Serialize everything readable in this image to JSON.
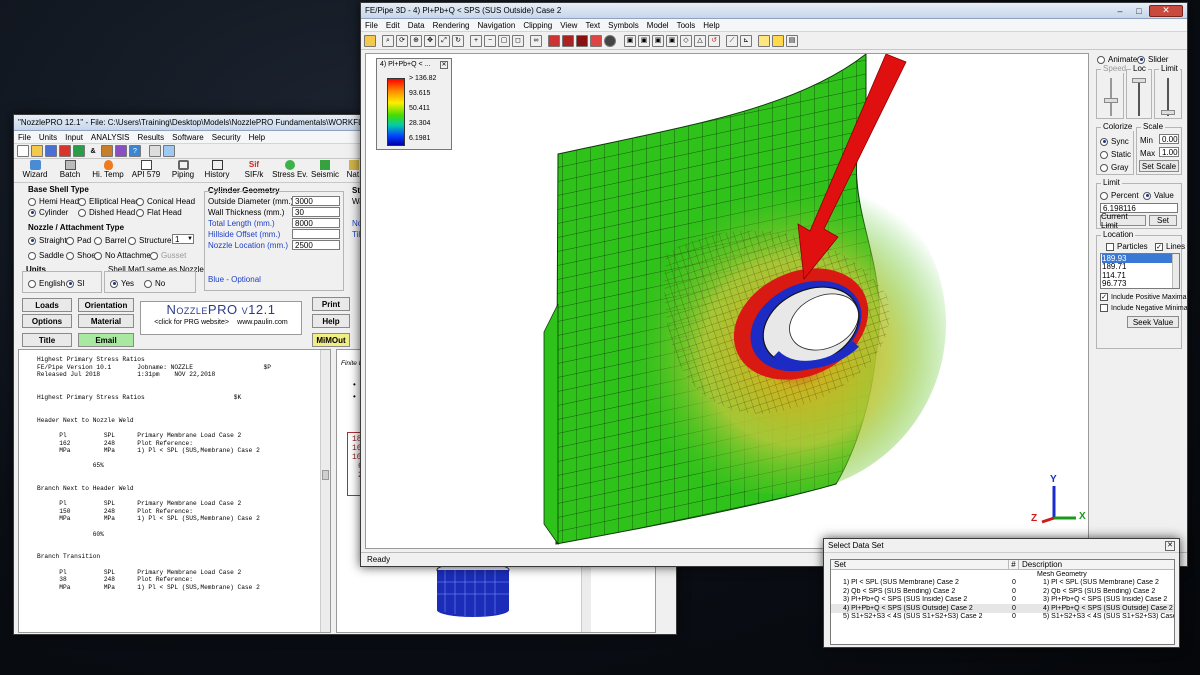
{
  "nozzle_window": {
    "title": "\"NozzlePRO 12.1\" - File: C:\\Users\\Training\\Desktop\\Models\\NozzlePRO Fundamentals\\WORKFLOW",
    "menu": [
      "File",
      "Units",
      "Input",
      "ANALYSIS",
      "Results",
      "Software",
      "Security",
      "Help"
    ],
    "toolbar": [
      "Wizard",
      "Batch",
      "Hi. Temp",
      "API 579",
      "Piping",
      "History",
      "SIF/k",
      "Stress Ev.",
      "Seismic",
      "Nat."
    ],
    "base_shell": {
      "title": "Base Shell Type",
      "options": [
        "Hemi Head",
        "Elliptical Head",
        "Conical Head",
        "Cylinder",
        "Dished Head",
        "Flat Head"
      ],
      "selected": "Cylinder"
    },
    "cylinder": {
      "title": "Cylinder Geometry",
      "fields": [
        {
          "label": "Outside Diameter (mm.)",
          "value": "3000",
          "blue": false
        },
        {
          "label": "Wall Thickness (mm.)",
          "value": "30",
          "blue": false
        },
        {
          "label": "Total Length (mm.)",
          "value": "8000",
          "blue": true
        },
        {
          "label": "Hillside Offset (mm.)",
          "value": "",
          "blue": true
        },
        {
          "label": "Nozzle Location (mm.)",
          "value": "2500",
          "blue": true
        }
      ],
      "note": "Blue - Optional"
    },
    "partial_labels": [
      "St",
      "Wa",
      "No",
      "Tilt"
    ],
    "nozzle_type": {
      "title": "Nozzle / Attachment Type",
      "options": [
        "Straight",
        "Pad",
        "Barrel",
        "Structure",
        "Saddle",
        "Shoe",
        "No Attachment",
        "Gusset"
      ],
      "selected": "Straight",
      "count": "1"
    },
    "units": {
      "title": "Units",
      "options": [
        "English",
        "SI"
      ],
      "selected": "SI"
    },
    "shell_mat": {
      "title": "Shell Mat'l same as Nozzle",
      "options": [
        "Yes",
        "No"
      ],
      "selected": "Yes"
    },
    "buttons": [
      "Loads",
      "Orientation",
      "Options",
      "Material",
      "Title",
      "Email"
    ],
    "side_buttons": [
      "Print",
      "Help",
      "MiMOut"
    ],
    "banner": {
      "title": "NozzlePRO v12.1",
      "link": "<click for PRG website>",
      "url": "www.paulin.com"
    },
    "report": [
      "Highest Primary Stress Ratios",
      "FE/Pipe Version 10.1       Jobname: NOZZLE                   $P",
      "Released Jul 2018          1:31pm    NOV 22,2018",
      "",
      "",
      "Highest Primary Stress Ratios                        $K",
      "",
      "",
      "Header Next to Nozzle Weld",
      "",
      "      Pl          SPL      Primary Membrane Load Case 2",
      "      162         248      Plot Reference:",
      "      MPa         MPa      1) Pl < SPL (SUS,Membrane) Case 2",
      "",
      "               65%",
      "",
      "",
      "Branch Next to Header Weld",
      "",
      "      Pl          SPL      Primary Membrane Load Case 2",
      "      150         248      Plot Reference:",
      "      MPa         MPa      1) Pl < SPL (SUS,Membrane) Case 2",
      "",
      "               60%",
      "",
      "",
      "Branch Transition",
      "",
      "      Pl          SPL      Primary Membrane Load Case 2",
      "      38          248      Plot Reference:",
      "      MPa         MPa      1) Pl < SPL (SUS,Membrane) Case 2"
    ],
    "right_pane": {
      "header": "Finite El",
      "numbers": [
        "18",
        "16",
        "10",
        "6",
        "2"
      ]
    }
  },
  "fepipe_window": {
    "title": "FE/Pipe 3D - 4) Pl+Pb+Q < SPS (SUS Outside) Case 2",
    "menu": [
      "File",
      "Edit",
      "Data",
      "Rendering",
      "Navigation",
      "Clipping",
      "View",
      "Text",
      "Symbols",
      "Model",
      "Tools",
      "Help"
    ],
    "legend": {
      "title": "4) Pl+Pb+Q < ...",
      "values": [
        "> 136.82",
        "93.615",
        "50.411",
        "28.304",
        "6.1981"
      ]
    },
    "status": "Ready",
    "axes": {
      "x": "X",
      "y": "Y",
      "z": "Z"
    },
    "panel": {
      "mode_options": [
        "Animate",
        "Slider"
      ],
      "mode_selected": "Slider",
      "slider_labels": [
        "Speed",
        "Loc",
        "Limit"
      ],
      "colorize": {
        "title": "Colorize",
        "options": [
          "Sync",
          "Static",
          "Gray"
        ],
        "selected": "Sync"
      },
      "scale": {
        "title": "Scale",
        "min_label": "Min",
        "min": "0.00",
        "max_label": "Max",
        "max": "1.00",
        "button": "Set Scale"
      },
      "limit": {
        "title": "Limit",
        "options": [
          "Percent",
          "Value"
        ],
        "selected": "Value",
        "value": "6.198116",
        "current_btn": "Current Limit",
        "set_btn": "Set"
      },
      "location": {
        "title": "Location",
        "particles": "Particles",
        "lines": "Lines",
        "items": [
          "189.93",
          "189.71",
          "114.71",
          "96.773"
        ]
      },
      "include_pos": "Include Positive Maxima",
      "include_neg": "Include Negative Minima",
      "seek": "Seek Value"
    }
  },
  "dataset_window": {
    "title": "Select Data Set",
    "headers": [
      "Set",
      "#",
      "Description"
    ],
    "rows": [
      {
        "set": "",
        "num": "",
        "desc": "Mesh Geometry"
      },
      {
        "set": "1) Pl < SPL (SUS Membrane) Case 2",
        "num": "0",
        "desc": "1) Pl < SPL (SUS Membrane) Case 2"
      },
      {
        "set": "2) Qb < SPS (SUS Bending) Case 2",
        "num": "0",
        "desc": "2) Qb < SPS (SUS Bending) Case 2"
      },
      {
        "set": "3) Pl+Pb+Q < SPS (SUS Inside) Case 2",
        "num": "0",
        "desc": "3) Pl+Pb+Q < SPS (SUS Inside) Case 2"
      },
      {
        "set": "4) Pl+Pb+Q < SPS (SUS Outside) Case 2",
        "num": "0",
        "desc": "4) Pl+Pb+Q < SPS (SUS Outside) Case 2"
      },
      {
        "set": "5) S1+S2+S3 < 4S (SUS S1+S2+S3) Case 2",
        "num": "0",
        "desc": "5) S1+S2+S3 < 4S (SUS S1+S2+S3) Case 2"
      }
    ],
    "selected_index": 4
  },
  "colors": {
    "mesh_green": "#2fc21a",
    "stress_red": "#e01010",
    "accent_blue": "#1c3fc5"
  }
}
